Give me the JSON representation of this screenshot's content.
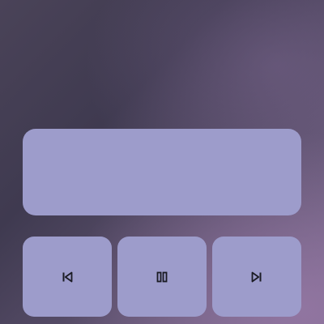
{
  "colors": {
    "panel": "#9d9ccb",
    "icon": "#1b1b24"
  },
  "media_controls": {
    "now_playing_panel": "",
    "buttons": [
      {
        "name": "previous",
        "icon": "skip-previous-icon"
      },
      {
        "name": "pause",
        "icon": "pause-icon"
      },
      {
        "name": "next",
        "icon": "skip-next-icon"
      }
    ]
  }
}
